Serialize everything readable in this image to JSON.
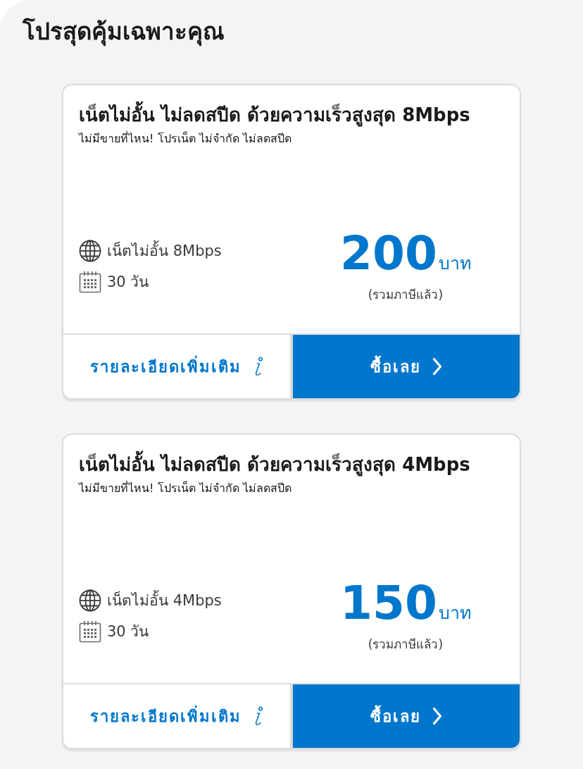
{
  "title": "โปรสุดคุ้มเฉพาะคุณ",
  "offers": [
    {
      "name": "เน็ตไม่อั้น ไม่ลดสปีด ด้วยความเร็วสูงสุด 8Mbps",
      "tagline": "ไม่มีขายที่ไหน! โปรเน็ต ไม่จำกัด ไม่ลดสปีด",
      "features": [
        {
          "kind": "internet",
          "text": "เน็ตไม่อั้น 8Mbps"
        },
        {
          "kind": "duration",
          "text": "30 วัน"
        }
      ],
      "price": "200",
      "currency": "บาท",
      "price_note": "(รวมภาษีแล้ว)",
      "details_button": "รายละเอียดเพิ่มเติม",
      "buy_button": "ซื้อเลย"
    },
    {
      "name": "เน็ตไม่อั้น ไม่ลดสปีด ด้วยความเร็วสูงสุด 4Mbps",
      "tagline": "ไม่มีขายที่ไหน! โปรเน็ต ไม่จำกัด ไม่ลดสปีด",
      "features": [
        {
          "kind": "internet",
          "text": "เน็ตไม่อั้น 4Mbps"
        },
        {
          "kind": "duration",
          "text": "30 วัน"
        }
      ],
      "price": "150",
      "currency": "บาท",
      "price_note": "(รวมภาษีแล้ว)",
      "details_button": "รายละเอียดเพิ่มเติม",
      "buy_button": "ซื้อเลย"
    }
  ]
}
